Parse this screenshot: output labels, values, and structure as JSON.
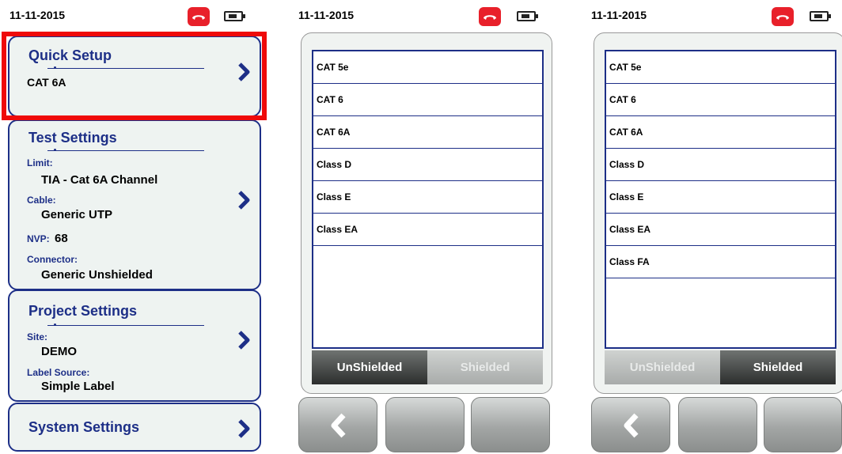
{
  "panel1": {
    "date": "11-11-2015",
    "quick_setup": {
      "title": "Quick Setup",
      "value": "CAT 6A"
    },
    "test_settings": {
      "title": "Test Settings",
      "limit_label": "Limit:",
      "limit_value": "TIA - Cat 6A Channel",
      "cable_label": "Cable:",
      "cable_value": "Generic UTP",
      "nvp_label": "NVP:",
      "nvp_value": "68",
      "connector_label": "Connector:",
      "connector_value": "Generic Unshielded"
    },
    "project_settings": {
      "title": "Project Settings",
      "site_label": "Site:",
      "site_value": "DEMO",
      "label_source_label": "Label Source:",
      "label_source_value": "Simple Label"
    },
    "system_settings": {
      "title": "System Settings"
    }
  },
  "panel2": {
    "date": "11-11-2015",
    "items": [
      "CAT 5e",
      "CAT 6",
      "CAT 6A",
      "Class D",
      "Class E",
      "Class EA"
    ],
    "segment": {
      "left": "UnShielded",
      "right": "Shielded",
      "active": "left"
    }
  },
  "panel3": {
    "date": "11-11-2015",
    "items": [
      "CAT 5e",
      "CAT 6",
      "CAT 6A",
      "Class D",
      "Class E",
      "Class EA",
      "Class FA"
    ],
    "segment": {
      "left": "UnShielded",
      "right": "Shielded",
      "active": "right"
    }
  },
  "icons": {
    "phone": "phone-hangup-icon",
    "battery": "battery-icon",
    "chevron": "chevron-right-icon",
    "back": "back-arrow-icon"
  },
  "colors": {
    "accent": "#1d2f87",
    "highlight": "#ef0a0a",
    "phone": "#e8202a"
  }
}
